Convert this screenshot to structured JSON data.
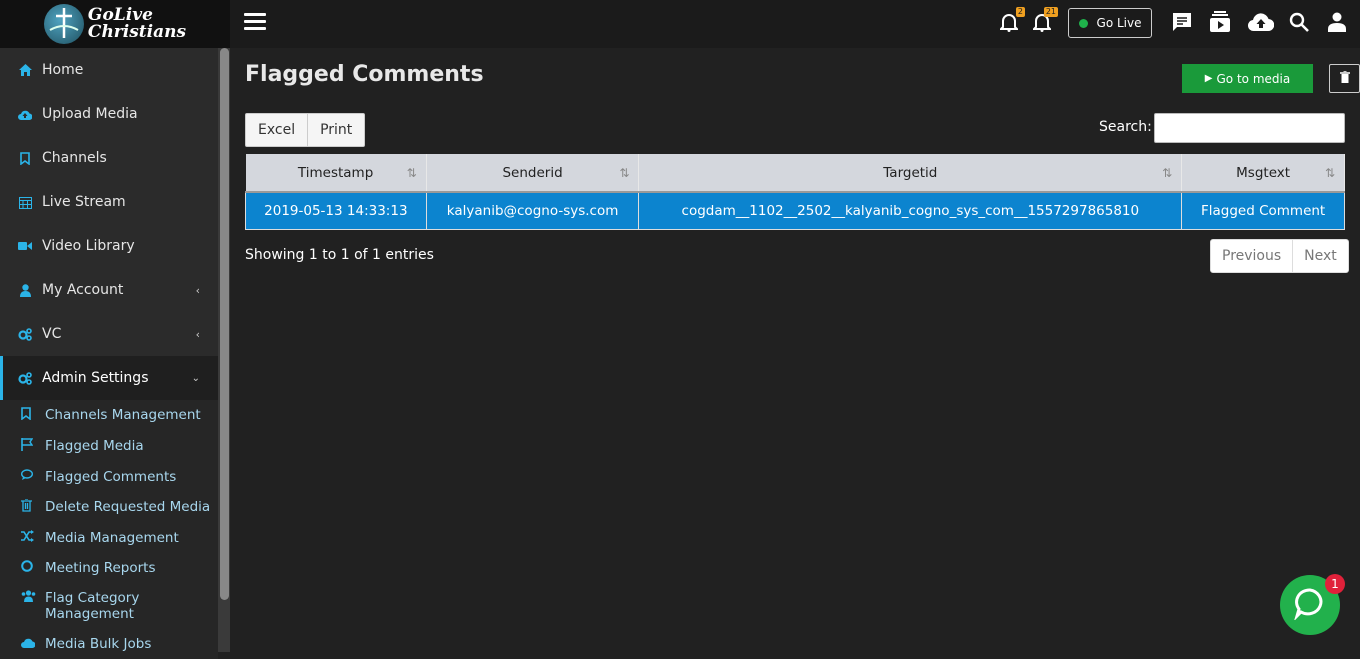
{
  "brand": {
    "logo_line1": "GoLive",
    "logo_line2": "Christians"
  },
  "sidebar": {
    "items": [
      {
        "label": "Home",
        "icon": "home-icon"
      },
      {
        "label": "Upload Media",
        "icon": "cloud-upload-icon"
      },
      {
        "label": "Channels",
        "icon": "bookmark-icon"
      },
      {
        "label": "Live Stream",
        "icon": "calendar-icon"
      },
      {
        "label": "Video Library",
        "icon": "video-camera-icon"
      },
      {
        "label": "My Account",
        "icon": "user-icon"
      },
      {
        "label": "VC",
        "icon": "cogs-icon"
      },
      {
        "label": "Admin Settings",
        "icon": "cogs-icon"
      }
    ],
    "sub_items": [
      {
        "label": "Channels Management",
        "icon": "bookmark-icon"
      },
      {
        "label": "Flagged Media",
        "icon": "flag-icon"
      },
      {
        "label": "Flagged Comments",
        "icon": "comments-icon"
      },
      {
        "label": "Delete Requested Media",
        "icon": "trash-icon"
      },
      {
        "label": "Media Management",
        "icon": "random-icon"
      },
      {
        "label": "Meeting Reports",
        "icon": "circle-icon"
      },
      {
        "label": "Flag Category Management",
        "icon": "users-icon"
      },
      {
        "label": "Media Bulk Jobs",
        "icon": "cloud-upload-icon"
      }
    ]
  },
  "topbar": {
    "notifications_count": "2",
    "alerts_count": "21",
    "go_live_label": "Go Live",
    "accent": "#1fb24b"
  },
  "main": {
    "title": "Flagged Comments",
    "go_to_media_label": "Go to media",
    "export_buttons": [
      "Excel",
      "Print"
    ],
    "search_label": "Search:",
    "search_value": "",
    "table": {
      "headers": [
        "Timestamp",
        "Senderid",
        "Targetid",
        "Msgtext"
      ],
      "rows": [
        [
          "2019-05-13 14:33:13",
          "kalyanib@cogno-sys.com",
          "cogdam__1102__2502__kalyanib_cogno_sys_com__1557297865810",
          "Flagged Comment"
        ]
      ]
    },
    "info": "Showing 1 to 1 of 1 entries",
    "pager": [
      "Previous",
      "Next"
    ]
  },
  "chat": {
    "badge": "1"
  }
}
